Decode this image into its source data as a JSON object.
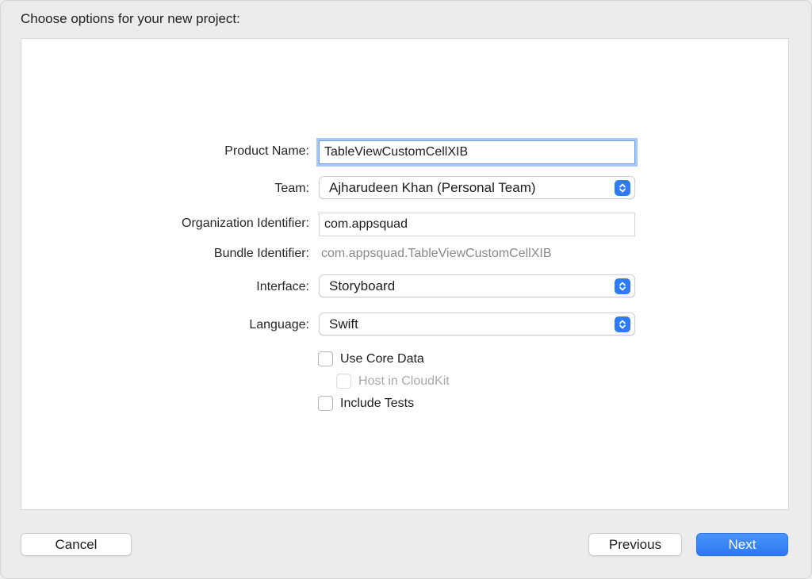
{
  "header": {
    "title": "Choose options for your new project:"
  },
  "form": {
    "product_name": {
      "label": "Product Name:",
      "value": "TableViewCustomCellXIB"
    },
    "team": {
      "label": "Team:",
      "value": "Ajharudeen Khan (Personal Team)"
    },
    "organization_identifier": {
      "label": "Organization Identifier:",
      "value": "com.appsquad"
    },
    "bundle_identifier": {
      "label": "Bundle Identifier:",
      "value": "com.appsquad.TableViewCustomCellXIB"
    },
    "interface": {
      "label": "Interface:",
      "value": "Storyboard"
    },
    "language": {
      "label": "Language:",
      "value": "Swift"
    },
    "use_core_data": {
      "label": "Use Core Data",
      "checked": false
    },
    "host_in_cloudkit": {
      "label": "Host in CloudKit",
      "checked": false,
      "enabled": false
    },
    "include_tests": {
      "label": "Include Tests",
      "checked": false
    }
  },
  "footer": {
    "cancel_label": "Cancel",
    "previous_label": "Previous",
    "next_label": "Next"
  },
  "colors": {
    "accent": "#2f7bf5",
    "focus_ring": "#a9c8f3"
  },
  "icons": {
    "popup_arrows": "chevron-up-down-icon"
  }
}
